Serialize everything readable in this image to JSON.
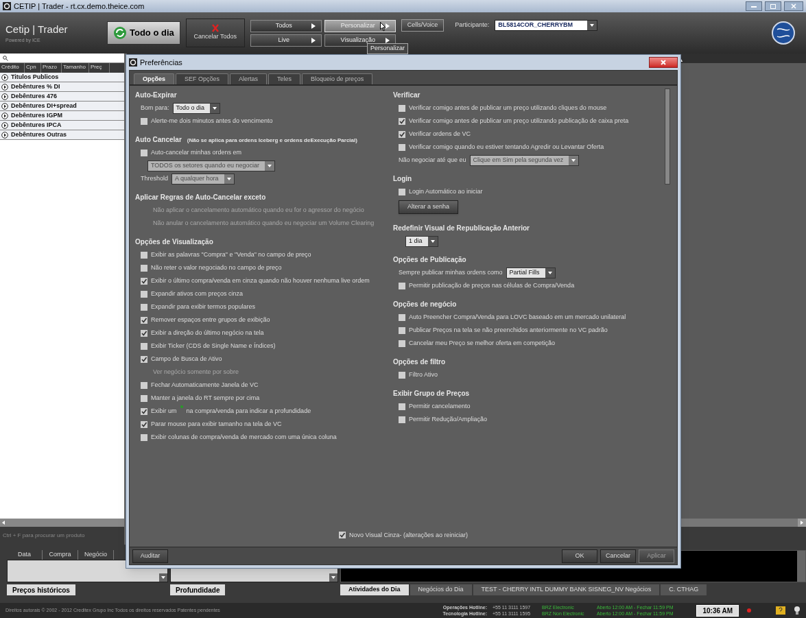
{
  "window": {
    "title": "CETIP | Trader - rt.cx.demo.theice.com"
  },
  "toolbar": {
    "logo": "Cetip | Trader",
    "logo_sub": "Powered by ICE",
    "period": "Todo o dia",
    "cancel_all": "Cancelar Todos",
    "menus": [
      {
        "label": "Todos",
        "selected": false
      },
      {
        "label": "Live",
        "selected": false
      },
      {
        "label": "Personalizar",
        "selected": true
      },
      {
        "label": "Visualização",
        "selected": false
      }
    ],
    "cells_voice": "Cells/Voice",
    "participant_label": "Participante:",
    "participant": "BL5814COR_CHERRYBM",
    "tooltip": "Personalizar"
  },
  "left_panel": {
    "columns": [
      "Crédito",
      "Cpn",
      "Prazo",
      "Tamanho",
      "Preç"
    ],
    "groups": [
      "Titulos Publicos",
      "Debêntures % DI",
      "Debêntures 476",
      "Debêntures DI+spread",
      "Debêntures IGPM",
      "Debêntures IPCA",
      "Debêntures Outras"
    ],
    "hint": "Ctrl + F para procurar um produto"
  },
  "dialog": {
    "title": "Preferências",
    "tabs": [
      {
        "label": "Opções",
        "selected": true
      },
      {
        "label": "SEF Opções",
        "selected": false
      },
      {
        "label": "Alertas",
        "selected": false
      },
      {
        "label": "Teles",
        "selected": false
      },
      {
        "label": "Bloqueio de preços",
        "selected": false
      }
    ],
    "left_sections": [
      {
        "heading": "Auto-Expirar",
        "items": [
          {
            "kind": "select",
            "label": "Bom para:",
            "value": "Todo o dia",
            "disabled": false
          },
          {
            "kind": "checkbox",
            "label": "Alerte-me dois minutos antes do vencimento",
            "checked": false
          }
        ]
      },
      {
        "heading": "Auto Cancelar",
        "subheading": "(Não se aplica para ordens Iceberg e ordens deExecução Parcial)",
        "items": [
          {
            "kind": "checkbox",
            "label": "Auto-cancelar minhas ordens em",
            "checked": false
          },
          {
            "kind": "select",
            "value": "TODOS os setores quando eu negociar",
            "disabled": true
          },
          {
            "kind": "select",
            "label": "Threshold",
            "value": "A qualquer hora",
            "disabled": true
          }
        ]
      },
      {
        "heading": "Aplicar Regras de Auto-Cancelar exceto",
        "items": [
          {
            "kind": "note",
            "label": "Não aplicar o cancelamento automático quando eu for o agressor do negócio"
          },
          {
            "kind": "note",
            "label": "Não anular o cancelamento automático quando eu negociar um Volume Clearing"
          }
        ]
      },
      {
        "heading": "Opções de Visualização",
        "items": [
          {
            "kind": "checkbox",
            "label": "Exibir as palavras \"Compra\" e \"Venda\" no campo de preço",
            "checked": false
          },
          {
            "kind": "checkbox",
            "label": "Não reter o valor negociado no campo de preço",
            "checked": false
          },
          {
            "kind": "checkbox",
            "label": "Exibir o último compra/venda em cinza quando não houver nenhuma live ordem",
            "checked": true
          },
          {
            "kind": "checkbox",
            "label": "Expandir ativos com preços cinza",
            "checked": false
          },
          {
            "kind": "checkbox",
            "label": "Expandir para exibir termos populares",
            "checked": false
          },
          {
            "kind": "checkbox",
            "label": "Remover espaços entre grupos de exibição",
            "checked": true
          },
          {
            "kind": "checkbox",
            "label": "Exibir a direção do último negócio na tela",
            "checked": true
          },
          {
            "kind": "checkbox",
            "label": "Exibir Ticker (CDS de Single Name e Índices)",
            "checked": false
          },
          {
            "kind": "checkbox",
            "label": "Campo de Busca de Ativo",
            "checked": true
          },
          {
            "kind": "note",
            "label": "Ver negócio somente por sobre"
          },
          {
            "kind": "checkbox",
            "label": "Fechar Automaticamente Janela de VC",
            "checked": false
          },
          {
            "kind": "checkbox",
            "label": "Manter a janela do RT sempre por cima",
            "checked": false
          },
          {
            "kind": "checkbox",
            "label": "Exibir um",
            "label_after": "na compra/venda para indicar a profundidade",
            "checked": true
          },
          {
            "kind": "checkbox",
            "label": "Parar mouse para exibir tamanho na tela de VC",
            "checked": true
          },
          {
            "kind": "checkbox",
            "label": "Exibir colunas de compra/venda de mercado com uma única coluna",
            "checked": false
          }
        ]
      }
    ],
    "right_sections": [
      {
        "heading": "Verificar",
        "items": [
          {
            "kind": "checkbox",
            "label": "Verificar comigo antes de publicar um preço utilizando cliques do mouse",
            "checked": false
          },
          {
            "kind": "checkbox",
            "label": "Verificar comigo antes de publicar um preço utilizando publicação de caixa preta",
            "checked": true
          },
          {
            "kind": "checkbox",
            "label": "Verificar ordens de VC",
            "checked": true
          },
          {
            "kind": "checkbox",
            "label": "Verificar comigo quando eu estiver tentando Agredir ou Levantar Oferta",
            "checked": false
          },
          {
            "kind": "select",
            "label": "Não negociar até que eu",
            "value": "Clique em Sim pela segunda vez",
            "disabled": true
          }
        ]
      },
      {
        "heading": "Login",
        "items": [
          {
            "kind": "checkbox",
            "label": "Login Automático ao iniciar",
            "checked": false
          },
          {
            "kind": "button",
            "label": "Alterar a senha"
          }
        ]
      },
      {
        "heading": "Redefinir  Visual de Republicação Anterior",
        "items": [
          {
            "kind": "select",
            "value": "1 dia",
            "disabled": false
          }
        ]
      },
      {
        "heading": "Opções de Publicação",
        "items": [
          {
            "kind": "select",
            "label": "Sempre publicar minhas ordens como",
            "value": "Partial Fills",
            "disabled": false
          },
          {
            "kind": "checkbox",
            "label": "Permitir publicação de preços nas células de Compra/Venda",
            "checked": false
          }
        ]
      },
      {
        "heading": "Opções de negócio",
        "items": [
          {
            "kind": "checkbox",
            "label": "Auto Preencher Compra/Venda para LOVC baseado em um mercado unilateral",
            "checked": false
          },
          {
            "kind": "checkbox",
            "label": "Publicar Preços na tela se não preenchidos anteriormente no VC padrão",
            "checked": false
          },
          {
            "kind": "checkbox",
            "label": "Cancelar meu Preço se melhor oferta em competição",
            "checked": false
          }
        ]
      },
      {
        "heading": "Opções de filtro",
        "items": [
          {
            "kind": "checkbox",
            "label": "Filtro Ativo",
            "checked": false
          }
        ]
      },
      {
        "heading": "Exibir Grupo de Preços",
        "items": [
          {
            "kind": "checkbox",
            "label": "Permitir cancelamento",
            "checked": false
          },
          {
            "kind": "checkbox",
            "label": "Permitir Redução/Ampliação",
            "checked": false
          }
        ]
      }
    ],
    "footer_check": {
      "label": "Novo Visual Cinza- (alterações ao reiniciar)",
      "checked": true
    },
    "buttons": [
      {
        "label": "Auditar",
        "disabled": false
      },
      {
        "label": "OK",
        "disabled": false
      },
      {
        "label": "Cancelar",
        "disabled": false
      },
      {
        "label": "Aplicar",
        "disabled": true
      }
    ]
  },
  "bottom": {
    "history_columns": [
      "Data",
      "Compra",
      "Negócio"
    ],
    "panel_tabs": [
      {
        "label": "Preços históricos"
      },
      {
        "label": "Profundidade"
      }
    ],
    "activity_tabs": [
      {
        "label": "Atividades do Dia",
        "selected": true
      },
      {
        "label": "Negócios do Dia",
        "selected": false
      },
      {
        "label": "TEST - CHERRY INTL DUMMY BANK SISNEG_NV Negócios",
        "selected": false
      },
      {
        "label": "C. CTHAG",
        "selected": false
      }
    ]
  },
  "status_bar": {
    "copyright": "Direitos autorais © 2002 - 2012 Creditex Grupo Inc Todos os direitos reservados Patentes pendentes",
    "hotlines": [
      {
        "label": "Operações Hotline:",
        "phone": "+55 11 3111 1597",
        "market": "BRZ Electronic",
        "hours": "Aberto 12:00 AM - Fechar 11:59 PM"
      },
      {
        "label": "Tecnologia Hotline:",
        "phone": "+55 11 3111 1595",
        "market": "BRZ Non Electronic",
        "hours": "Aberto 12:00 AM - Fechar 11:59 PM"
      }
    ],
    "clock": "10:36 AM"
  }
}
